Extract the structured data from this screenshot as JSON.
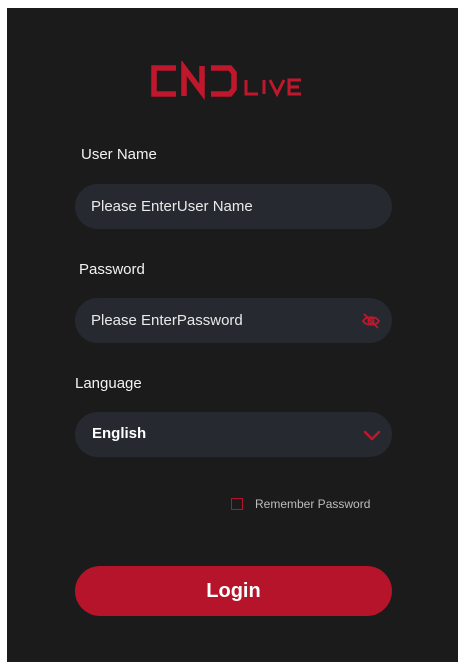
{
  "brand": {
    "logo_text": "CNDLIVE",
    "color": "#c0172c"
  },
  "form": {
    "username": {
      "label": "User Name",
      "placeholder": "Please EnterUser Name",
      "value": ""
    },
    "password": {
      "label": "Password",
      "placeholder": "Please EnterPassword",
      "value": "",
      "toggle_icon": "eye-slash-icon"
    },
    "language": {
      "label": "Language",
      "selected": "English",
      "icon": "chevron-down-icon"
    },
    "remember": {
      "label": "Remember Password",
      "checked": false
    },
    "login_label": "Login"
  },
  "colors": {
    "background": "#1b1b1b",
    "field": "#262a30",
    "accent": "#b5142a"
  }
}
